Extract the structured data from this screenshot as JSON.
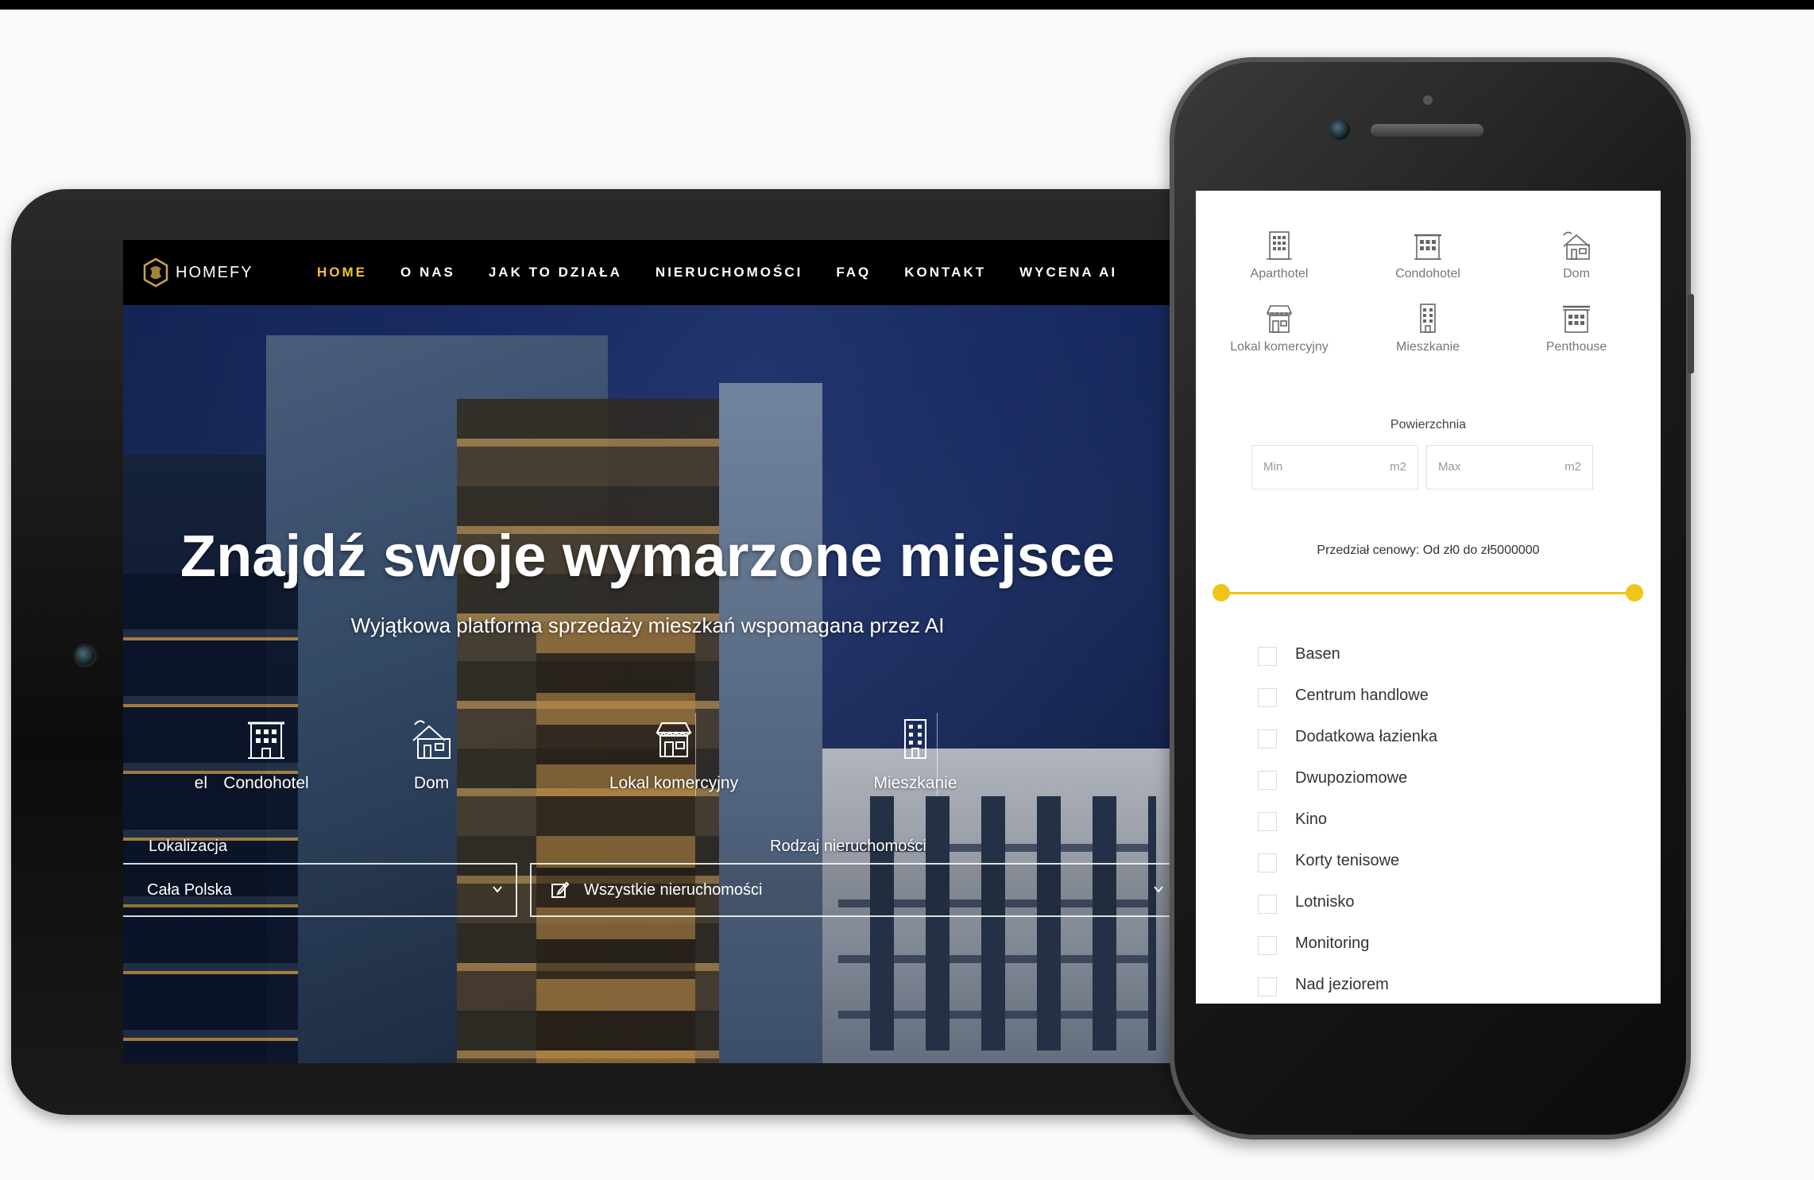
{
  "tablet": {
    "nav": {
      "brand": "HOMEFY",
      "items": [
        "HOME",
        "O NAS",
        "JAK TO DZIAŁA",
        "NIERUCHOMOŚCI",
        "FAQ",
        "KONTAKT",
        "WYCENA AI"
      ],
      "active_item": "HOME",
      "accent_color": "#f2c230"
    },
    "hero": {
      "title": "Znajdź swoje wymarzone miejsce",
      "subtitle": "Wyjątkowa platforma sprzedaży mieszkań wspomagana przez AI"
    },
    "categories": [
      {
        "label": "el",
        "icon": "building-icon"
      },
      {
        "label": "Condohotel",
        "icon": "building-icon"
      },
      {
        "label": "Dom",
        "icon": "house-icon"
      },
      {
        "label": "Lokal komercyjny",
        "icon": "storefront-icon"
      },
      {
        "label": "Mieszkanie",
        "icon": "apartment-icon"
      }
    ],
    "search": {
      "location_label": "Lokalizacja",
      "location_value": "Cała Polska",
      "type_label": "Rodzaj nieruchomości",
      "type_value": "Wszystkie nieruchomości"
    }
  },
  "phone": {
    "categories": [
      {
        "label": "Aparthotel",
        "icon": "building-icon"
      },
      {
        "label": "Condohotel",
        "icon": "building-icon"
      },
      {
        "label": "Dom",
        "icon": "house-icon"
      },
      {
        "label": "Lokal komercyjny",
        "icon": "storefront-icon"
      },
      {
        "label": "Mieszkanie",
        "icon": "apartment-icon"
      },
      {
        "label": "Penthouse",
        "icon": "building-icon"
      }
    ],
    "area": {
      "title": "Powierzchnia",
      "min_placeholder": "Min",
      "max_placeholder": "Max",
      "unit": "m2"
    },
    "price": {
      "label": "Przedział cenowy: Od zł0 do zł5000000",
      "range_low_fraction": 0,
      "range_high_fraction": 1,
      "slider_color": "#f0c419"
    },
    "amenities": [
      "Basen",
      "Centrum handlowe",
      "Dodatkowa łazienka",
      "Dwupoziomowe",
      "Kino",
      "Korty tenisowe",
      "Lotnisko",
      "Monitoring",
      "Nad jeziorem"
    ]
  }
}
